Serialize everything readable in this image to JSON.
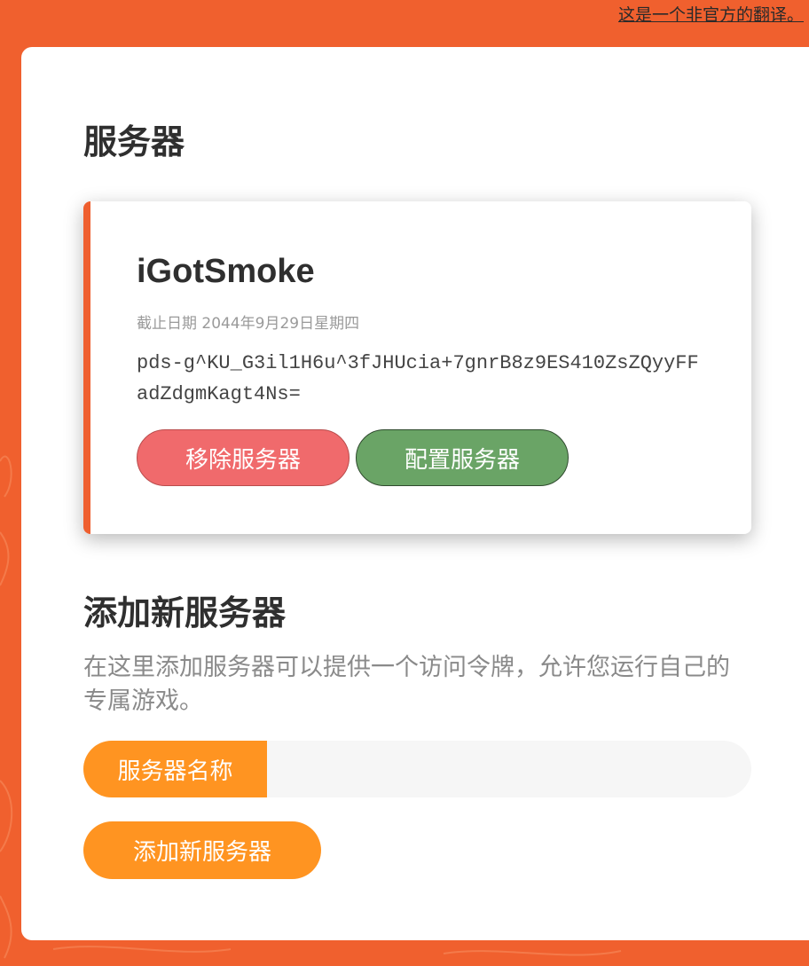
{
  "notice": "这是一个非官方的翻译。",
  "servers_heading": "服务器",
  "server": {
    "name": "iGotSmoke",
    "expiry": "截止日期 2044年9月29日星期四",
    "token": "pds-g^KU_G3il1H6u^3fJHUcia+7gnrB8z9ES410ZsZQyyFFadZdgmKagt4Ns=",
    "remove_label": "移除服务器",
    "configure_label": "配置服务器"
  },
  "add_section": {
    "heading": "添加新服务器",
    "description": "在这里添加服务器可以提供一个访问令牌，允许您运行自己的专属游戏。",
    "name_label": "服务器名称",
    "name_value": "",
    "add_button_label": "添加新服务器"
  },
  "colors": {
    "background": "#f0602e",
    "accent_orange": "#ff9421",
    "remove_red": "#f06a6c",
    "configure_green": "#6aa466"
  }
}
